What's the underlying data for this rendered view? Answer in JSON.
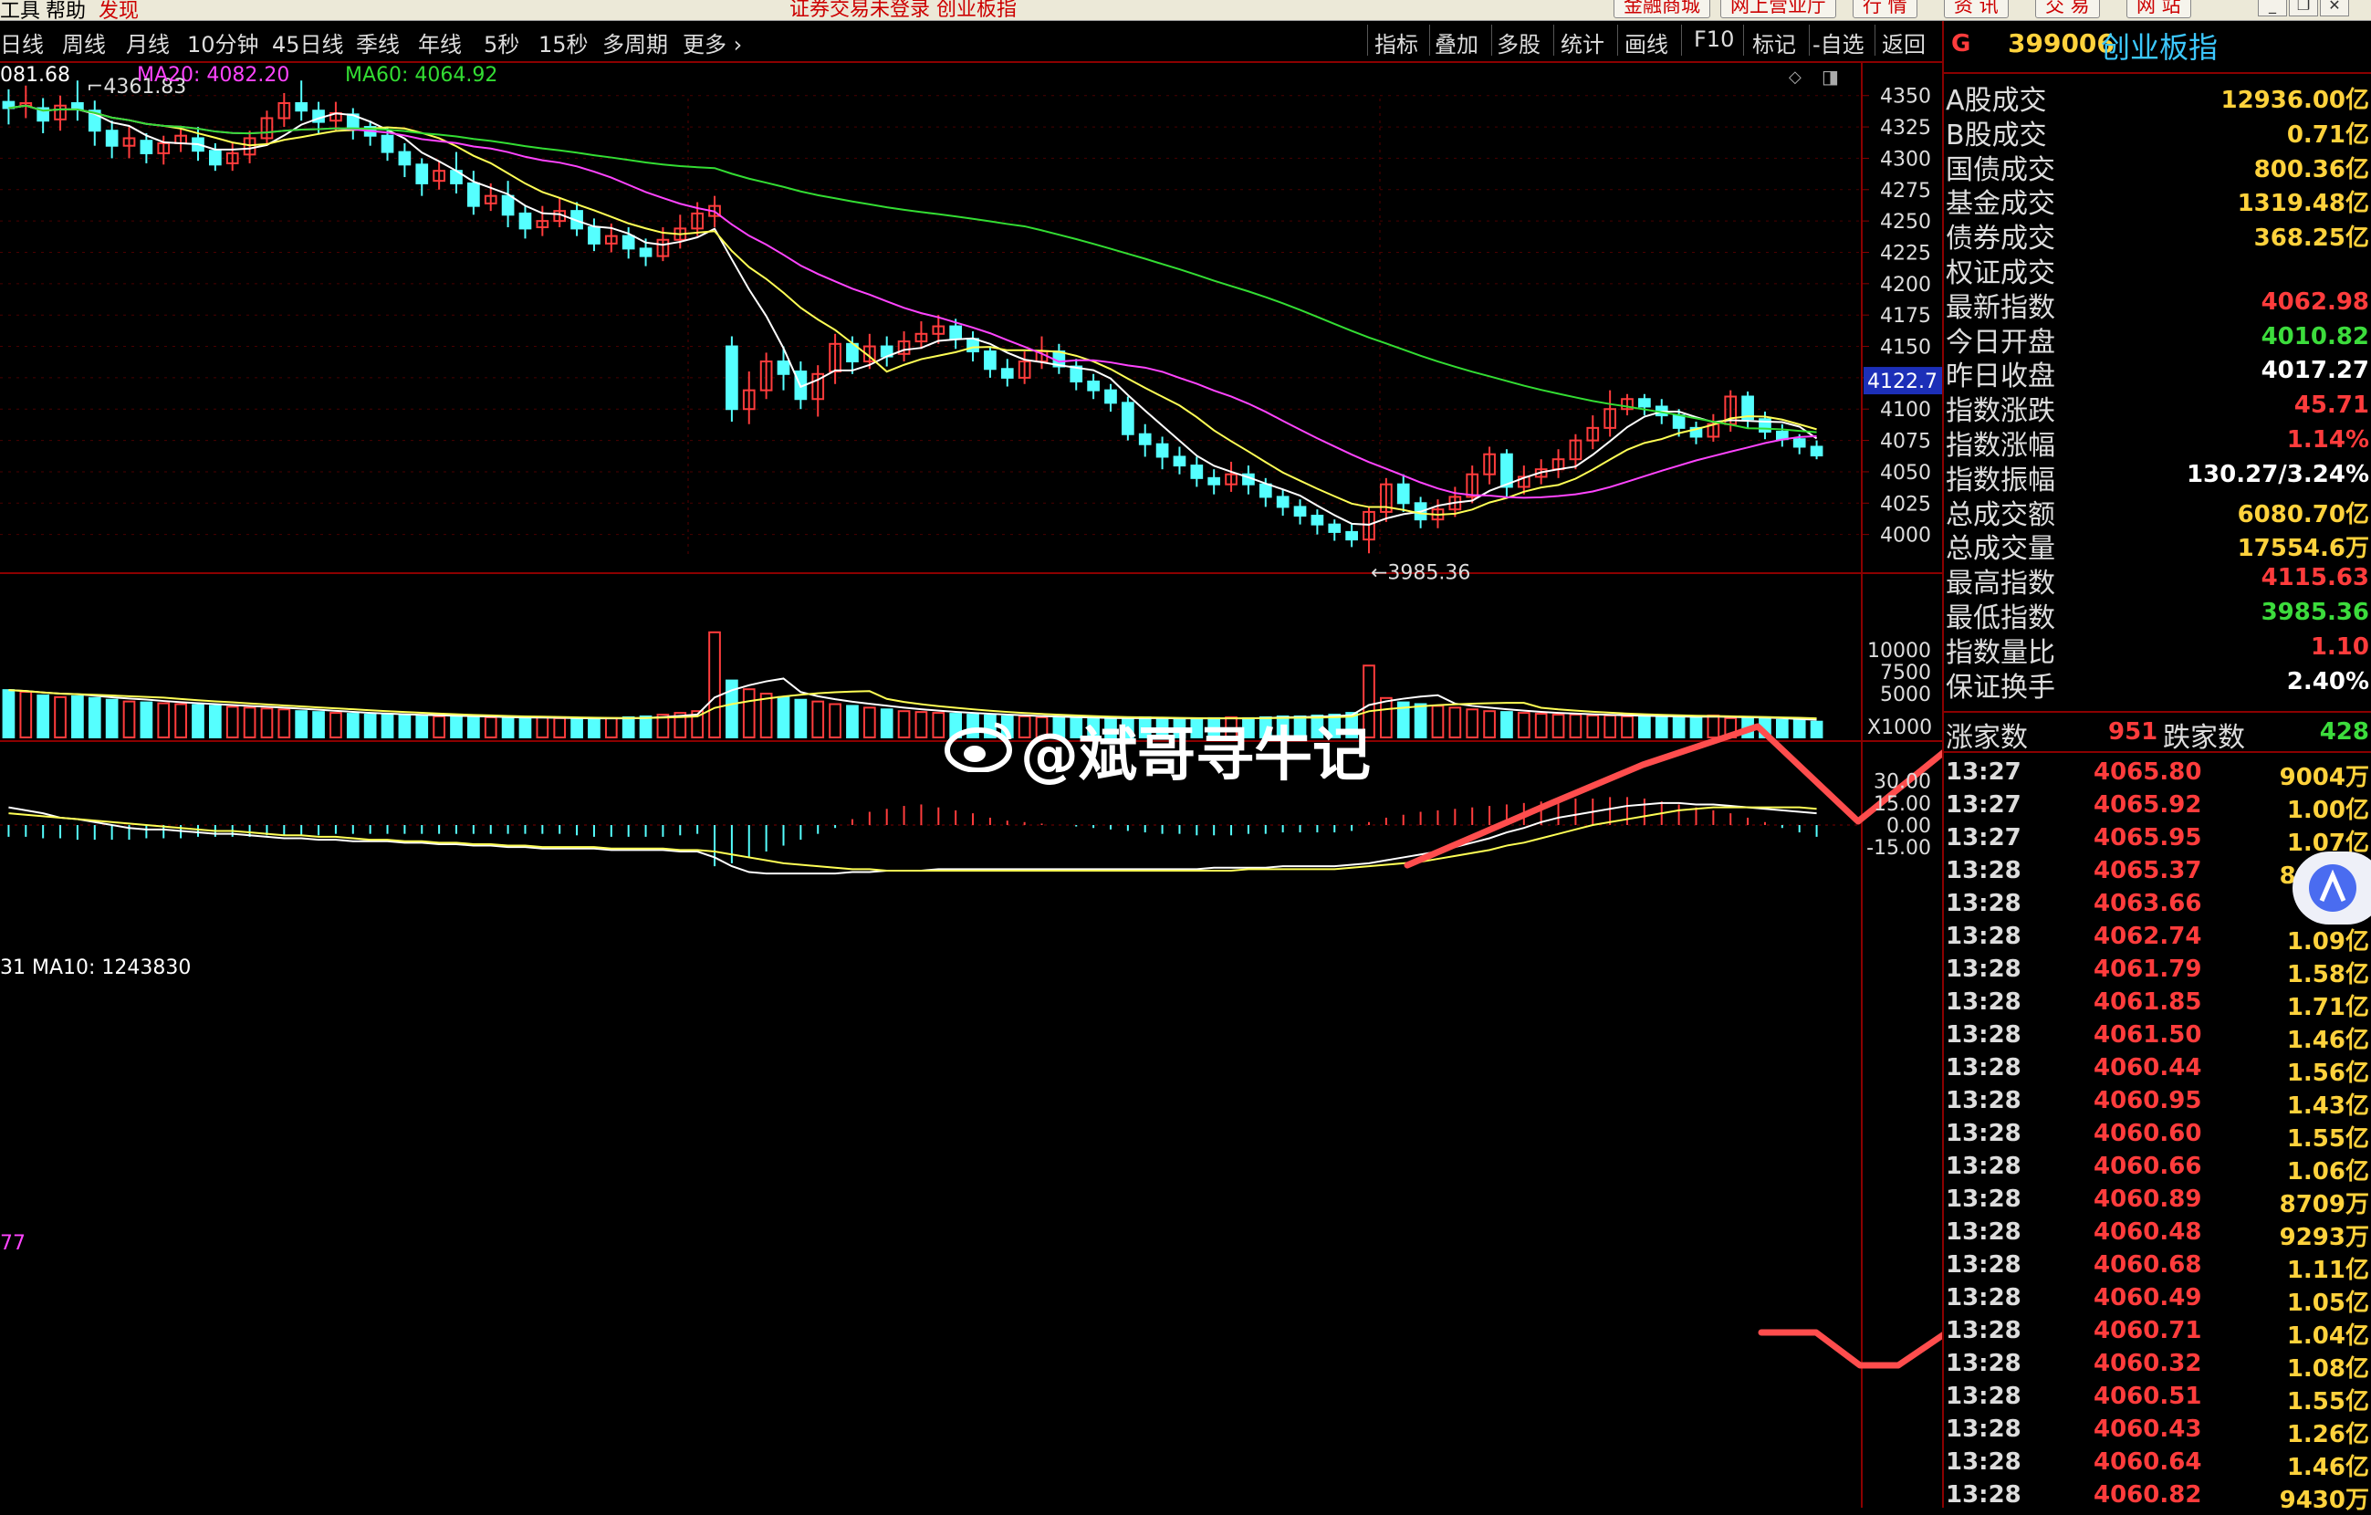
{
  "top_menu": {
    "tools": "工具",
    "help": "帮助",
    "discover": "发现",
    "notice": "证券交易未登录  创业板指",
    "mall": "金融商城",
    "office": "网上营业厅",
    "quote": "行  情",
    "info": "资  讯",
    "trade": "交  易",
    "web": "网  站"
  },
  "period_tabs": [
    "日线",
    "周线",
    "月线",
    "10分钟",
    "45日线",
    "季线",
    "年线",
    "5秒",
    "15秒",
    "多周期",
    "更多 ›"
  ],
  "tool_buttons": [
    "指标",
    "叠加",
    "多股",
    "统计",
    "画线",
    "F10",
    "标记",
    "-自选",
    "返回"
  ],
  "ma_legend": {
    "ma5": "081.68",
    "ma20": "MA20: 4082.20",
    "ma60": "MA60: 4064.92"
  },
  "volume_legend": "31  MA10: 1243830",
  "macd_legend": "77",
  "volume_unit": "X1000",
  "price_axis": [
    "4350",
    "4325",
    "4300",
    "4275",
    "4250",
    "4225",
    "4200",
    "4175",
    "4150",
    "4125",
    "4100",
    "4075",
    "4050",
    "4025",
    "4000"
  ],
  "volume_axis": [
    "10000",
    "7500",
    "5000"
  ],
  "macd_axis": [
    "30.00",
    "15.00",
    "0.00",
    "-15.00"
  ],
  "price_marker": "4122.7",
  "high_label": "4361.83",
  "low_label": "3985.36",
  "watermark": "@斌哥寻牛记",
  "panel": {
    "code_prefix": "G",
    "code": "399006",
    "name": "创业板指",
    "stats": [
      {
        "label": "A股成交",
        "value": "12936.00亿",
        "color": "#ffd23c"
      },
      {
        "label": "B股成交",
        "value": "0.71亿",
        "color": "#ffd23c"
      },
      {
        "label": "国债成交",
        "value": "800.36亿",
        "color": "#ffd23c"
      },
      {
        "label": "基金成交",
        "value": "1319.48亿",
        "color": "#ffd23c"
      },
      {
        "label": "债券成交",
        "value": "368.25亿",
        "color": "#ffd23c"
      },
      {
        "label": "权证成交",
        "value": "",
        "color": "#ffd23c"
      },
      {
        "label": "最新指数",
        "value": "4062.98",
        "color": "#ff3c3c"
      },
      {
        "label": "今日开盘",
        "value": "4010.82",
        "color": "#3cdc3c"
      },
      {
        "label": "昨日收盘",
        "value": "4017.27",
        "color": "#ffffff"
      },
      {
        "label": "指数涨跌",
        "value": "45.71",
        "color": "#ff3c3c"
      },
      {
        "label": "指数涨幅",
        "value": "1.14%",
        "color": "#ff3c3c"
      },
      {
        "label": "指数振幅",
        "value": "130.27/3.24%",
        "color": "#ffffff"
      },
      {
        "label": "总成交额",
        "value": "6080.70亿",
        "color": "#ffd23c"
      },
      {
        "label": "总成交量",
        "value": "17554.6万",
        "color": "#ffd23c"
      },
      {
        "label": "最高指数",
        "value": "4115.63",
        "color": "#ff3c3c"
      },
      {
        "label": "最低指数",
        "value": "3985.36",
        "color": "#3cdc3c"
      },
      {
        "label": "指数量比",
        "value": "1.10",
        "color": "#ff3c3c"
      },
      {
        "label": "保证换手",
        "value": "2.40%",
        "color": "#ffffff"
      }
    ],
    "up_label": "涨家数",
    "up_count": "951",
    "down_label": "跌家数",
    "down_count": "428",
    "ticks": [
      {
        "time": "13:27",
        "price": "4065.80",
        "vol": "9004万"
      },
      {
        "time": "13:27",
        "price": "4065.92",
        "vol": "1.00亿"
      },
      {
        "time": "13:27",
        "price": "4065.95",
        "vol": "1.07亿"
      },
      {
        "time": "13:28",
        "price": "4065.37",
        "vol": "8939万"
      },
      {
        "time": "13:28",
        "price": "4063.66",
        "vol": "1.5亿"
      },
      {
        "time": "13:28",
        "price": "4062.74",
        "vol": "1.09亿"
      },
      {
        "time": "13:28",
        "price": "4061.79",
        "vol": "1.58亿"
      },
      {
        "time": "13:28",
        "price": "4061.85",
        "vol": "1.71亿"
      },
      {
        "time": "13:28",
        "price": "4061.50",
        "vol": "1.46亿"
      },
      {
        "time": "13:28",
        "price": "4060.44",
        "vol": "1.56亿"
      },
      {
        "time": "13:28",
        "price": "4060.95",
        "vol": "1.43亿"
      },
      {
        "time": "13:28",
        "price": "4060.60",
        "vol": "1.55亿"
      },
      {
        "time": "13:28",
        "price": "4060.66",
        "vol": "1.06亿"
      },
      {
        "time": "13:28",
        "price": "4060.89",
        "vol": "8709万"
      },
      {
        "time": "13:28",
        "price": "4060.48",
        "vol": "9293万"
      },
      {
        "time": "13:28",
        "price": "4060.68",
        "vol": "1.11亿"
      },
      {
        "time": "13:28",
        "price": "4060.49",
        "vol": "1.05亿"
      },
      {
        "time": "13:28",
        "price": "4060.71",
        "vol": "1.04亿"
      },
      {
        "time": "13:28",
        "price": "4060.32",
        "vol": "1.08亿"
      },
      {
        "time": "13:28",
        "price": "4060.51",
        "vol": "1.55亿"
      },
      {
        "time": "13:28",
        "price": "4060.43",
        "vol": "1.26亿"
      },
      {
        "time": "13:28",
        "price": "4060.64",
        "vol": "1.46亿"
      },
      {
        "time": "13:28",
        "price": "4060.82",
        "vol": "9430万"
      }
    ]
  },
  "chart_data": {
    "type": "candlestick",
    "price_range": [
      3975,
      4368
    ],
    "volume_range": [
      0,
      12500
    ],
    "macd_range": [
      -30,
      36
    ],
    "candles": [
      [
        4345,
        4340,
        4355,
        4327
      ],
      [
        4342,
        4344,
        4358,
        4332
      ],
      [
        4340,
        4330,
        4348,
        4320
      ],
      [
        4331,
        4342,
        4350,
        4322
      ],
      [
        4344,
        4339,
        4362,
        4330
      ],
      [
        4338,
        4322,
        4346,
        4310
      ],
      [
        4322,
        4310,
        4330,
        4300
      ],
      [
        4310,
        4316,
        4325,
        4300
      ],
      [
        4314,
        4304,
        4320,
        4296
      ],
      [
        4304,
        4312,
        4318,
        4295
      ],
      [
        4312,
        4318,
        4326,
        4305
      ],
      [
        4316,
        4306,
        4325,
        4298
      ],
      [
        4306,
        4295,
        4312,
        4290
      ],
      [
        4296,
        4304,
        4312,
        4290
      ],
      [
        4303,
        4316,
        4322,
        4296
      ],
      [
        4316,
        4332,
        4338,
        4310
      ],
      [
        4332,
        4344,
        4352,
        4325
      ],
      [
        4344,
        4338,
        4362,
        4330
      ],
      [
        4338,
        4329,
        4345,
        4320
      ],
      [
        4330,
        4336,
        4345,
        4322
      ],
      [
        4335,
        4325,
        4340,
        4315
      ],
      [
        4325,
        4318,
        4330,
        4310
      ],
      [
        4318,
        4305,
        4325,
        4298
      ],
      [
        4305,
        4295,
        4312,
        4285
      ],
      [
        4295,
        4280,
        4300,
        4270
      ],
      [
        4282,
        4290,
        4298,
        4275
      ],
      [
        4290,
        4280,
        4305,
        4272
      ],
      [
        4280,
        4262,
        4290,
        4255
      ],
      [
        4264,
        4270,
        4280,
        4258
      ],
      [
        4270,
        4255,
        4282,
        4245
      ],
      [
        4256,
        4244,
        4262,
        4236
      ],
      [
        4245,
        4250,
        4262,
        4238
      ],
      [
        4250,
        4258,
        4268,
        4245
      ],
      [
        4258,
        4244,
        4265,
        4238
      ],
      [
        4245,
        4232,
        4252,
        4226
      ],
      [
        4232,
        4238,
        4248,
        4225
      ],
      [
        4238,
        4228,
        4245,
        4220
      ],
      [
        4228,
        4222,
        4236,
        4214
      ],
      [
        4222,
        4235,
        4245,
        4218
      ],
      [
        4235,
        4244,
        4255,
        4228
      ],
      [
        4244,
        4256,
        4265,
        4238
      ],
      [
        4254,
        4262,
        4270,
        4245
      ],
      [
        4150,
        4100,
        4158,
        4090
      ],
      [
        4100,
        4115,
        4130,
        4088
      ],
      [
        4115,
        4138,
        4145,
        4108
      ],
      [
        4138,
        4128,
        4150,
        4115
      ],
      [
        4130,
        4108,
        4138,
        4100
      ],
      [
        4108,
        4128,
        4135,
        4094
      ],
      [
        4130,
        4152,
        4160,
        4120
      ],
      [
        4152,
        4138,
        4158,
        4128
      ],
      [
        4138,
        4150,
        4160,
        4132
      ],
      [
        4150,
        4142,
        4158,
        4134
      ],
      [
        4144,
        4154,
        4162,
        4138
      ],
      [
        4154,
        4160,
        4170,
        4148
      ],
      [
        4160,
        4166,
        4175,
        4152
      ],
      [
        4166,
        4156,
        4172,
        4148
      ],
      [
        4156,
        4146,
        4162,
        4138
      ],
      [
        4146,
        4132,
        4150,
        4125
      ],
      [
        4132,
        4125,
        4140,
        4118
      ],
      [
        4125,
        4138,
        4146,
        4120
      ],
      [
        4138,
        4146,
        4158,
        4132
      ],
      [
        4146,
        4134,
        4152,
        4128
      ],
      [
        4134,
        4122,
        4140,
        4115
      ],
      [
        4122,
        4115,
        4128,
        4108
      ],
      [
        4115,
        4105,
        4120,
        4098
      ],
      [
        4105,
        4080,
        4110,
        4075
      ],
      [
        4080,
        4072,
        4088,
        4062
      ],
      [
        4072,
        4062,
        4078,
        4052
      ],
      [
        4062,
        4055,
        4070,
        4048
      ],
      [
        4055,
        4045,
        4062,
        4038
      ],
      [
        4045,
        4040,
        4052,
        4032
      ],
      [
        4040,
        4048,
        4058,
        4034
      ],
      [
        4048,
        4040,
        4055,
        4032
      ],
      [
        4040,
        4030,
        4045,
        4022
      ],
      [
        4030,
        4022,
        4036,
        4015
      ],
      [
        4022,
        4015,
        4028,
        4008
      ],
      [
        4015,
        4008,
        4020,
        4000
      ],
      [
        4008,
        4002,
        4012,
        3995
      ],
      [
        4002,
        3996,
        4008,
        3990
      ],
      [
        3996,
        4018,
        4022,
        3985
      ],
      [
        4018,
        4040,
        4045,
        4010
      ],
      [
        4040,
        4025,
        4048,
        4018
      ],
      [
        4025,
        4012,
        4030,
        4005
      ],
      [
        4012,
        4020,
        4028,
        4005
      ],
      [
        4020,
        4030,
        4038,
        4014
      ],
      [
        4030,
        4048,
        4055,
        4025
      ],
      [
        4048,
        4064,
        4070,
        4040
      ],
      [
        4064,
        4038,
        4068,
        4030
      ],
      [
        4038,
        4046,
        4055,
        4032
      ],
      [
        4046,
        4052,
        4060,
        4040
      ],
      [
        4052,
        4060,
        4068,
        4045
      ],
      [
        4060,
        4075,
        4080,
        4052
      ],
      [
        4075,
        4085,
        4095,
        4068
      ],
      [
        4085,
        4100,
        4115,
        4078
      ],
      [
        4100,
        4108,
        4112,
        4095
      ],
      [
        4108,
        4102,
        4112,
        4095
      ],
      [
        4102,
        4095,
        4108,
        4088
      ],
      [
        4095,
        4085,
        4100,
        4078
      ],
      [
        4085,
        4078,
        4090,
        4072
      ],
      [
        4078,
        4088,
        4096,
        4074
      ],
      [
        4088,
        4110,
        4115,
        4082
      ],
      [
        4110,
        4092,
        4114,
        4085
      ],
      [
        4092,
        4082,
        4098,
        4076
      ],
      [
        4082,
        4076,
        4088,
        4070
      ],
      [
        4076,
        4070,
        4080,
        4064
      ],
      [
        4070,
        4063,
        4075,
        4060
      ]
    ],
    "volumes": [
      5400,
      5200,
      4800,
      4600,
      4700,
      4500,
      4300,
      4100,
      4000,
      3900,
      3800,
      3700,
      3600,
      3500,
      3400,
      3300,
      3200,
      3000,
      2900,
      2800,
      2700,
      2600,
      2600,
      2500,
      2500,
      2400,
      2400,
      2300,
      2300,
      2200,
      2200,
      2300,
      2200,
      2100,
      2100,
      2200,
      2300,
      2400,
      2600,
      2800,
      3000,
      12000,
      6500,
      5500,
      5000,
      4600,
      4300,
      4100,
      3800,
      3600,
      3400,
      3200,
      3000,
      2900,
      2800,
      2700,
      2600,
      2500,
      2400,
      2400,
      2300,
      2300,
      2200,
      2200,
      2100,
      2200,
      2300,
      2200,
      2100,
      2100,
      2200,
      2300,
      2200,
      2300,
      2400,
      2400,
      2500,
      2600,
      2800,
      8200,
      4500,
      4000,
      3800,
      3600,
      3400,
      3200,
      3000,
      2900,
      2800,
      2700,
      2600,
      2600,
      2500,
      2500,
      2400,
      2400,
      2400,
      2300,
      2300,
      2500,
      2200,
      2200,
      2100,
      2000,
      2000,
      1800
    ],
    "macd_hist": [
      -8,
      -8,
      -9,
      -9,
      -10,
      -10,
      -10,
      -10,
      -9,
      -9,
      -9,
      -8,
      -8,
      -8,
      -8,
      -7,
      -7,
      -7,
      -7,
      -6,
      -6,
      -6,
      -6,
      -6,
      -6,
      -6,
      -6,
      -6,
      -6,
      -6,
      -6,
      -6,
      -6,
      -7,
      -8,
      -8,
      -8,
      -8,
      -8,
      -7,
      -6,
      -28,
      -26,
      -22,
      -18,
      -14,
      -10,
      -6,
      -2,
      4,
      9,
      11,
      13,
      14,
      12,
      10,
      8,
      5,
      3,
      2,
      1,
      0,
      -1,
      -2,
      -3,
      -4,
      -5,
      -6,
      -6,
      -7,
      -7,
      -7,
      -6,
      -6,
      -5,
      -5,
      -5,
      -5,
      -4,
      2,
      5,
      7,
      9,
      10,
      11,
      12,
      13,
      14,
      15,
      16,
      17,
      18,
      18,
      19,
      19,
      18,
      16,
      14,
      12,
      10,
      8,
      5,
      2,
      -2,
      -5,
      -8
    ],
    "macd_dif": [
      12,
      10,
      8,
      5,
      4,
      2,
      0,
      -2,
      -3,
      -3,
      -4,
      -5,
      -6,
      -6,
      -7,
      -8,
      -9,
      -9,
      -10,
      -10,
      -11,
      -11,
      -11,
      -12,
      -12,
      -13,
      -13,
      -14,
      -14,
      -15,
      -15,
      -16,
      -16,
      -16,
      -16,
      -17,
      -17,
      -17,
      -17,
      -18,
      -18,
      -22,
      -28,
      -32,
      -33,
      -33,
      -33,
      -33,
      -33,
      -32,
      -32,
      -31,
      -31,
      -31,
      -30,
      -30,
      -30,
      -30,
      -30,
      -30,
      -30,
      -30,
      -30,
      -30,
      -30,
      -30,
      -30,
      -30,
      -30,
      -30,
      -29,
      -29,
      -29,
      -29,
      -28,
      -28,
      -28,
      -28,
      -27,
      -26,
      -24,
      -22,
      -20,
      -18,
      -15,
      -12,
      -9,
      -5,
      -2,
      2,
      5,
      7,
      9,
      11,
      13,
      14,
      15,
      15,
      14,
      14,
      13,
      12,
      11,
      10,
      9,
      8
    ],
    "macd_dea": [
      8,
      7,
      6,
      5,
      4,
      3,
      2,
      1,
      0,
      -1,
      -2,
      -3,
      -4,
      -4,
      -5,
      -6,
      -7,
      -7,
      -8,
      -8,
      -9,
      -10,
      -10,
      -11,
      -11,
      -12,
      -12,
      -13,
      -13,
      -14,
      -14,
      -15,
      -15,
      -15,
      -15,
      -16,
      -16,
      -16,
      -16,
      -17,
      -17,
      -18,
      -20,
      -22,
      -24,
      -26,
      -27,
      -28,
      -29,
      -30,
      -30,
      -31,
      -31,
      -31,
      -31,
      -31,
      -31,
      -31,
      -31,
      -31,
      -31,
      -31,
      -31,
      -31,
      -31,
      -31,
      -31,
      -31,
      -31,
      -31,
      -31,
      -31,
      -30,
      -30,
      -30,
      -30,
      -30,
      -30,
      -29,
      -28,
      -27,
      -26,
      -25,
      -23,
      -21,
      -19,
      -17,
      -14,
      -12,
      -9,
      -6,
      -3,
      0,
      2,
      4,
      6,
      8,
      10,
      11,
      12,
      12,
      12,
      12,
      12,
      12,
      11
    ]
  },
  "colors": {
    "up": "#ff3c3c",
    "down": "#55ffff",
    "ma5": "#ffffff",
    "ma10": "#ffff55",
    "ma20": "#ff44ff",
    "ma60": "#33dd33",
    "axis": "#8b0000",
    "annotation": "#ff4d4d"
  }
}
